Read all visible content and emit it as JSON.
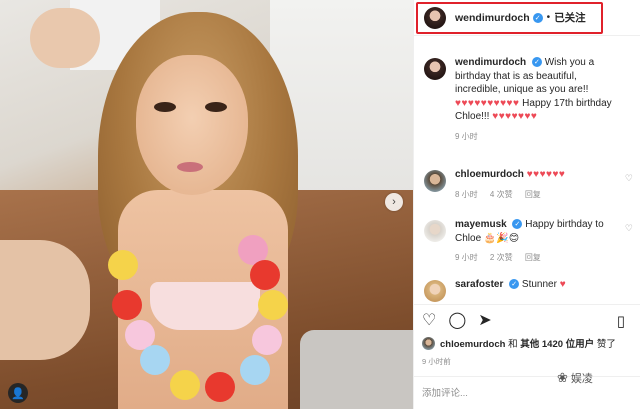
{
  "header": {
    "username": "wendimurdoch",
    "separator": "•",
    "follow_status": "已关注"
  },
  "caption": {
    "username": "wendimurdoch",
    "text_1": "Wish you a birthday that is as beautiful, incredible, unique as you are!!",
    "hearts_1": "♥♥♥♥♥♥♥♥♥♥",
    "text_2": "Happy 17th birthday Chloe!!!",
    "hearts_2": "♥♥♥♥♥♥♥",
    "time": "9 小时"
  },
  "comments": [
    {
      "username": "chloemurdoch",
      "text": "",
      "hearts": "♥♥♥♥♥♥",
      "time": "8 小时",
      "likes": "4 次赞",
      "reply": "回复"
    },
    {
      "username": "mayemusk",
      "text": "Happy birthday to Chloe 🎂🎉😊",
      "hearts": "",
      "time": "9 小时",
      "likes": "2 次赞",
      "reply": "回复"
    },
    {
      "username": "sarafoster",
      "text": "Stunner",
      "hearts": "♥",
      "time": "",
      "likes": "",
      "reply": ""
    }
  ],
  "actions": {
    "like_icon": "heart-outline-icon",
    "comment_icon": "comment-icon",
    "share_icon": "share-icon",
    "save_icon": "bookmark-icon"
  },
  "likes": {
    "username": "chloemurdoch",
    "and": "和",
    "others": "其他 1420 位用户",
    "suffix": "赞了"
  },
  "post_time": "9 小时前",
  "add_comment_placeholder": "添加评论...",
  "watermark": "娱凌",
  "colors": {
    "verified": "#3897f0",
    "heart": "#ed4956",
    "highlight_box": "#e0212b"
  }
}
